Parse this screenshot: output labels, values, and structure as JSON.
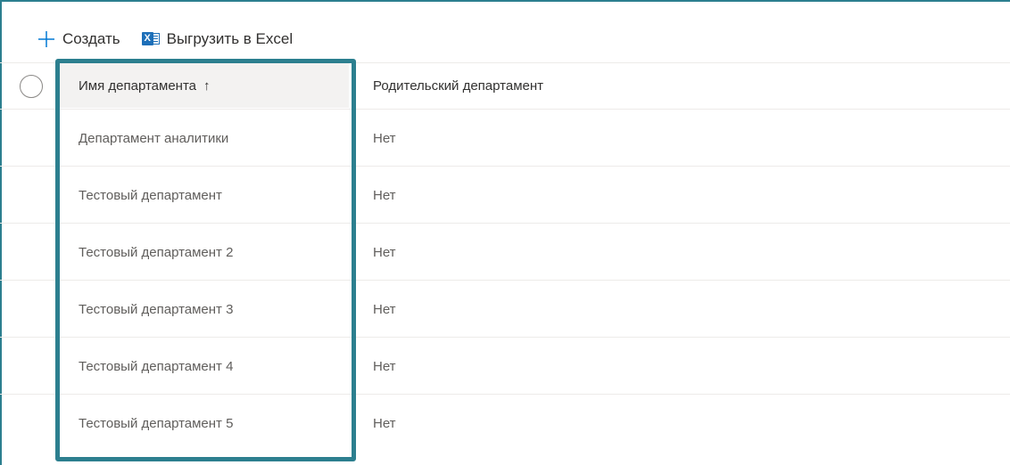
{
  "toolbar": {
    "create_label": "Создать",
    "export_label": "Выгрузить в Excel"
  },
  "table": {
    "columns": [
      {
        "label": "Имя департамента",
        "sort": "↑"
      },
      {
        "label": "Родительский департамент"
      }
    ],
    "rows": [
      {
        "name": "Департамент аналитики",
        "parent": "Нет"
      },
      {
        "name": "Тестовый департамент",
        "parent": "Нет"
      },
      {
        "name": "Тестовый департамент 2",
        "parent": "Нет"
      },
      {
        "name": "Тестовый департамент 3",
        "parent": "Нет"
      },
      {
        "name": "Тестовый департамент 4",
        "parent": "Нет"
      },
      {
        "name": "Тестовый департамент 5",
        "parent": "Нет"
      }
    ]
  },
  "colors": {
    "accent": "#2c7f8f",
    "excel": "#1d6fb8",
    "header_bg": "#f3f2f1",
    "plus": "#0078d4"
  },
  "icons": {
    "create": "plus-icon",
    "export": "excel-icon"
  }
}
